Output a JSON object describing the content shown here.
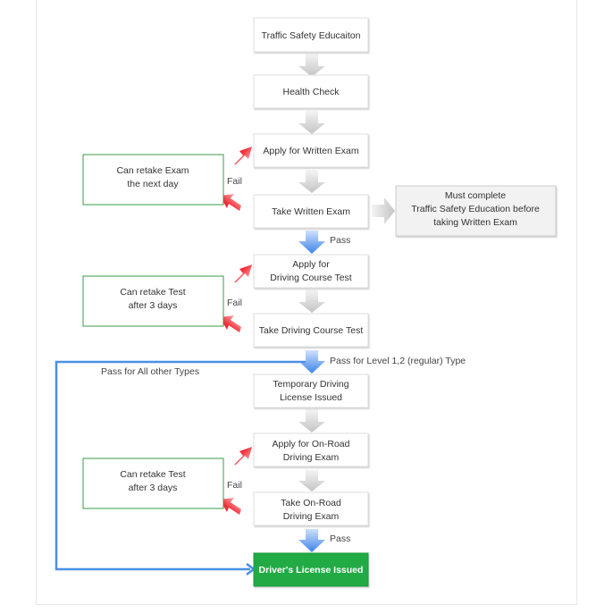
{
  "nodes": [
    {
      "lines": [
        "Traffic Safety Educaiton"
      ]
    },
    {
      "lines": [
        "Health Check"
      ]
    },
    {
      "lines": [
        "Apply for Written Exam"
      ]
    },
    {
      "lines": [
        "Take Written Exam"
      ]
    },
    {
      "lines": [
        "Apply for",
        "Driving Course Test"
      ]
    },
    {
      "lines": [
        "Take Driving Course Test"
      ]
    },
    {
      "lines": [
        "Temporary Driving",
        "License Issued"
      ]
    },
    {
      "lines": [
        "Apply for On-Road",
        "Driving Exam"
      ]
    },
    {
      "lines": [
        "Take On-Road",
        "Driving Exam"
      ]
    },
    {
      "lines": [
        "Driver's License Issued"
      ]
    }
  ],
  "note": {
    "lines": [
      "Must complete",
      "Traffic Safety Education before",
      "taking Written Exam"
    ]
  },
  "retake": [
    {
      "lines": [
        "Can retake Exam",
        "the next day"
      ]
    },
    {
      "lines": [
        "Can retake Test",
        "after 3 days"
      ]
    },
    {
      "lines": [
        "Can retake Test",
        "after 3 days"
      ]
    }
  ],
  "labels": {
    "fail": "Fail",
    "pass": "Pass",
    "pass_regular": "Pass for Level 1,2 (regular) Type",
    "pass_other": "Pass for All other Types"
  },
  "colors": {
    "pass_arrow": "#4a8fe8",
    "fail_arrow": "#f0202a",
    "final_box": "#22aa44",
    "retake_border": "#3a9a4a"
  }
}
